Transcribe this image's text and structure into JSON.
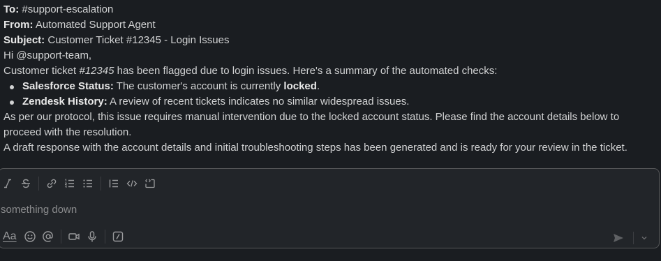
{
  "message": {
    "to_label": "To:",
    "to_value": "#support-escalation",
    "from_label": "From:",
    "from_value": "Automated Support Agent",
    "subject_label": "Subject:",
    "subject_value": "Customer Ticket #12345 - Login Issues",
    "greeting": "Hi @support-team,",
    "intro_pre": "Customer ticket ",
    "intro_ticket": "#12345",
    "intro_post": " has been flagged due to login issues. Here's a summary of the automated checks:",
    "checks": [
      {
        "label": "Salesforce Status:",
        "text_pre": " The customer's account is currently ",
        "text_strong": "locked",
        "text_post": "."
      },
      {
        "label": "Zendesk History:",
        "text": " A review of recent tickets indicates no similar widespread issues."
      }
    ],
    "protocol": "As per our protocol, this issue requires manual intervention due to the locked account status. Please find the account details below to proceed with the resolution.",
    "draft": "A draft response with the account details and initial troubleshooting steps has been generated and is ready for your review in the ticket."
  },
  "composer": {
    "placeholder_text": "something down",
    "format_label": "Aa",
    "toolbar_icons": [
      "italic-icon",
      "strikethrough-icon",
      "link-icon",
      "ordered-list-icon",
      "bulleted-list-icon",
      "blockquote-icon",
      "code-icon",
      "code-block-icon"
    ],
    "bottom_icons": [
      "emoji-icon",
      "mention-icon",
      "video-icon",
      "microphone-icon",
      "slash-command-icon"
    ],
    "send_icons": [
      "send-icon",
      "chevron-down-icon"
    ]
  }
}
